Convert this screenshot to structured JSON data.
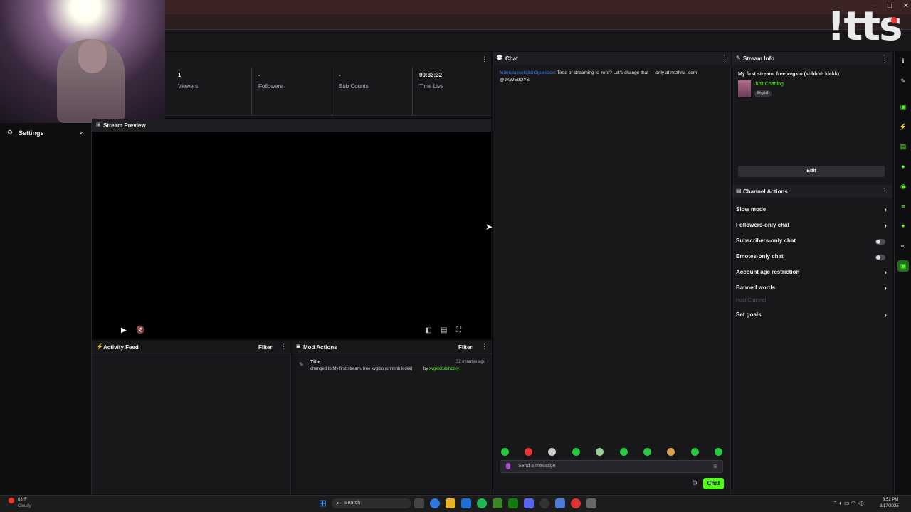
{
  "window": {
    "minimize": "–",
    "maximize": "□",
    "close": "✕"
  },
  "logo_text": "!tts",
  "nav": {
    "settings_label": "Settings"
  },
  "stats": [
    {
      "value": "1",
      "label": "Viewers"
    },
    {
      "value": "-",
      "label": "Followers"
    },
    {
      "value": "-",
      "label": "Sub Counts"
    },
    {
      "value": "00:33:32",
      "label": "Time Live"
    }
  ],
  "preview": {
    "title": "Stream Preview"
  },
  "activity": {
    "title": "Activity Feed",
    "filter": "Filter"
  },
  "mod_actions": {
    "title": "Mod Actions",
    "filter": "Filter",
    "entry": {
      "title": "Title",
      "time": "32 minutes ago",
      "text": "changed to My first stream. free xvgkio (shhhhh kickk)",
      "by_prefix": "by",
      "by_user": "xvgkiotutshzzky"
    }
  },
  "chat": {
    "title": "Chat",
    "message_user": "federalassets3cn0guessov",
    "message_text": ": Tired of streaming to zero? Let's change that — only at nezhna .com @JKWEdQYS",
    "input_placeholder": "Send a message",
    "send_label": "Chat"
  },
  "stream_info": {
    "title": "Stream Info",
    "stream_title": "My first stream. free xvgkio (shhhhh kickk)",
    "category": "Just Chatting",
    "language": "English",
    "edit_label": "Edit"
  },
  "channel_actions": {
    "title": "Channel Actions",
    "items": [
      {
        "label": "Slow mode",
        "control": "chevron"
      },
      {
        "label": "Followers-only chat",
        "control": "chevron"
      },
      {
        "label": "Subscribers-only chat",
        "control": "toggle"
      },
      {
        "label": "Emotes-only chat",
        "control": "toggle"
      },
      {
        "label": "Account age restriction",
        "control": "chevron"
      },
      {
        "label": "Banned words",
        "control": "chevron"
      },
      {
        "label": "Host Channel",
        "control": "none",
        "disabled": true
      },
      {
        "label": "Set goals",
        "control": "chevron"
      }
    ]
  },
  "taskbar": {
    "weather_temp": "83°F",
    "weather_desc": "Cloudy",
    "search_placeholder": "Search",
    "clock_time": "8:52 PM",
    "clock_date": "8/17/2025"
  },
  "colors": {
    "accent": "#53fc18",
    "background": "#0e0e10",
    "panel": "#18181b"
  }
}
